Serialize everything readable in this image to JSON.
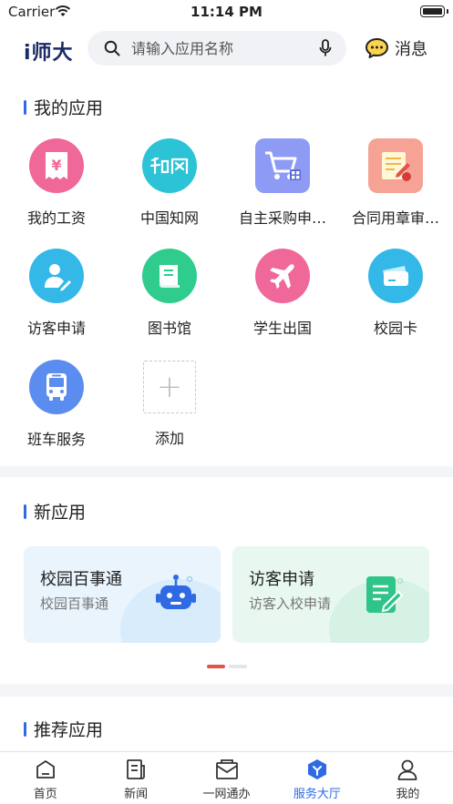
{
  "status_bar": {
    "carrier": "Carrier",
    "time": "11:14 PM"
  },
  "header": {
    "logo_i": "i",
    "logo_text": "师大",
    "search_placeholder": "请输入应用名称",
    "messages_label": "消息"
  },
  "my_apps": {
    "title": "我的应用",
    "items": [
      {
        "label": "我的工资",
        "icon": "salary-icon",
        "color": "#f0679a"
      },
      {
        "label": "中国知网",
        "icon": "cnki-icon",
        "color": "#2cc3d6"
      },
      {
        "label": "自主采购申…",
        "icon": "shopping-cart-icon",
        "color": "#7b8cf2"
      },
      {
        "label": "合同用章审…",
        "icon": "contract-seal-icon",
        "color": "#f38a7e"
      },
      {
        "label": "访客申请",
        "icon": "visitor-icon",
        "color": "#33b8e8"
      },
      {
        "label": "图书馆",
        "icon": "library-book-icon",
        "color": "#2fcc8e"
      },
      {
        "label": "学生出国",
        "icon": "airplane-icon",
        "color": "#f0679a"
      },
      {
        "label": "校园卡",
        "icon": "campus-card-icon",
        "color": "#33b8e8"
      },
      {
        "label": "班车服务",
        "icon": "bus-icon",
        "color": "#5b8df0"
      },
      {
        "label": "添加",
        "icon": "add-icon",
        "color": "#c8c8c8"
      }
    ]
  },
  "new_apps": {
    "title": "新应用",
    "cards": [
      {
        "title": "校园百事通",
        "subtitle": "校园百事通",
        "icon": "robot-icon",
        "bg": "#e9f4fd",
        "accent": "#2f6ae4"
      },
      {
        "title": "访客申请",
        "subtitle": "访客入校申请",
        "icon": "form-edit-icon",
        "bg": "#e8f8f1",
        "accent": "#2fc48a"
      }
    ],
    "active_page": 1,
    "page_count": 2
  },
  "recommended": {
    "title": "推荐应用"
  },
  "tab_bar": {
    "items": [
      {
        "label": "首页",
        "icon": "home-icon"
      },
      {
        "label": "新闻",
        "icon": "news-icon"
      },
      {
        "label": "一网通办",
        "icon": "mail-service-icon"
      },
      {
        "label": "服务大厅",
        "icon": "service-hall-icon",
        "active": true
      },
      {
        "label": "我的",
        "icon": "profile-icon"
      }
    ],
    "active_color": "#2f6ae4"
  }
}
